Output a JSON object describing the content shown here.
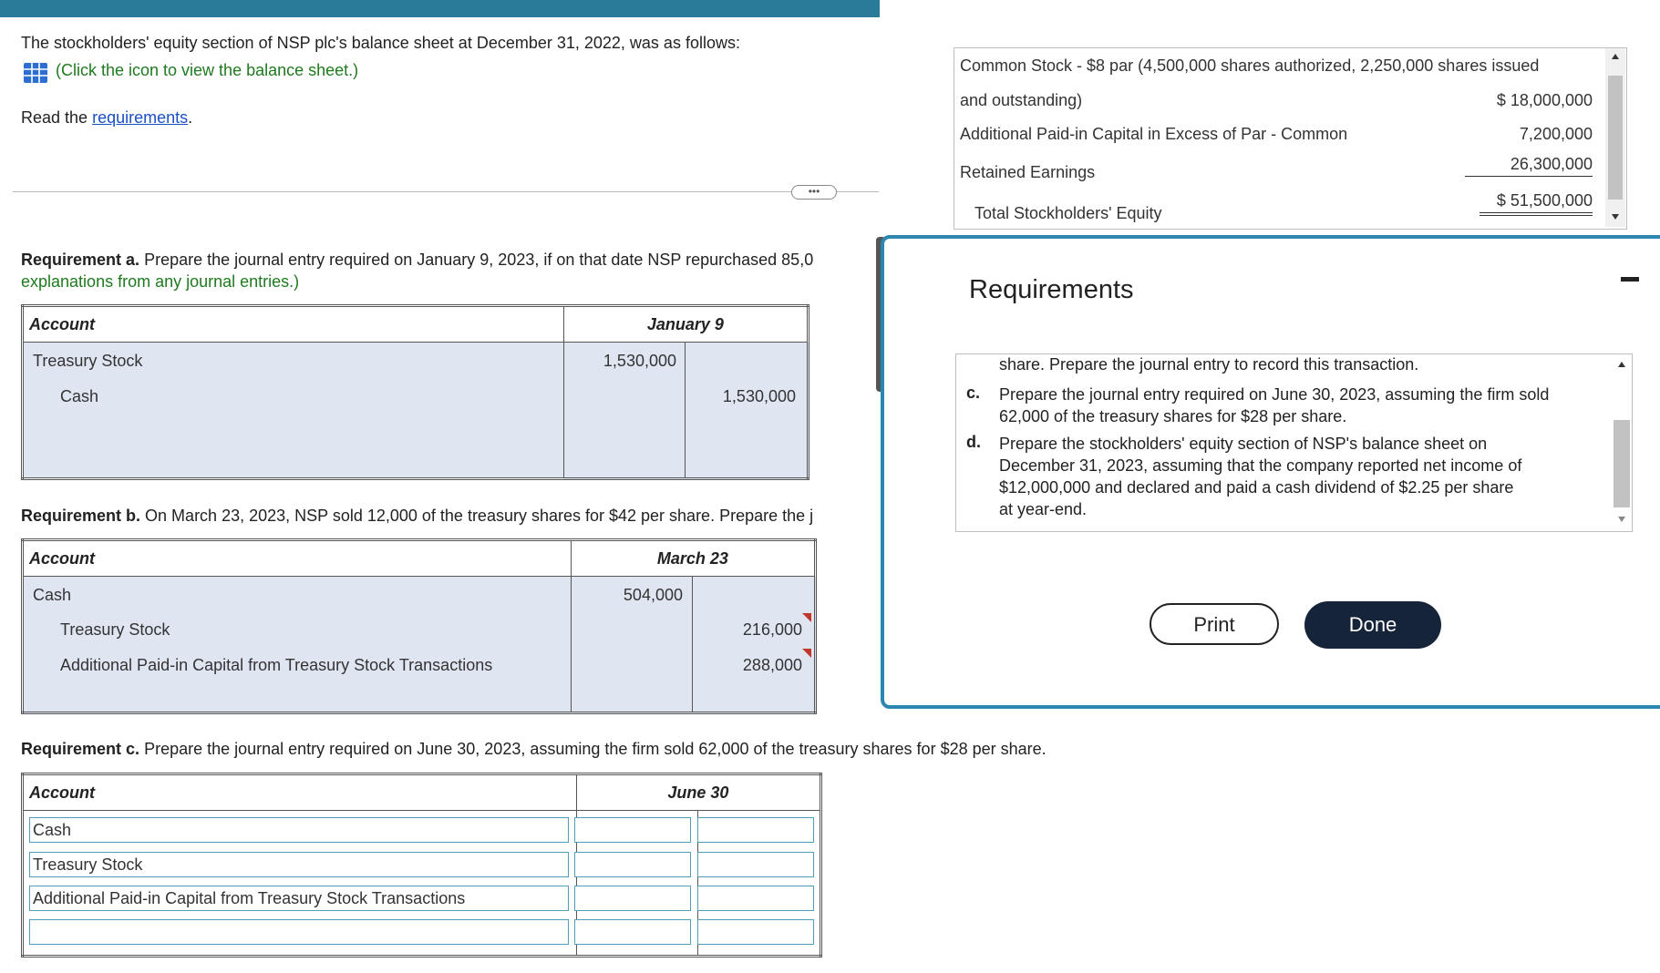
{
  "intro": {
    "line1": "The stockholders' equity section of NSP plc's balance sheet at December 31, 2022, was as follows:",
    "click_icon": "(Click the icon to view the balance sheet.)",
    "read_prefix": "Read the",
    "read_link": "requirements",
    "read_suffix": "."
  },
  "more_dots": "•••",
  "req_a": {
    "head": "Requirement a.",
    "text": "Prepare the journal entry required on January 9, 2023, if on that date NSP repurchased 85,0",
    "text2": "explanations from any journal entries.)",
    "col_account": "Account",
    "col_date": "January 9",
    "rows": [
      {
        "account": "Treasury Stock",
        "debit": "1,530,000",
        "credit": ""
      },
      {
        "account": "Cash",
        "debit": "",
        "credit": "1,530,000"
      }
    ]
  },
  "req_b": {
    "head": "Requirement b.",
    "text": "On March 23, 2023, NSP sold 12,000 of the treasury shares for $42 per share. Prepare the j",
    "col_account": "Account",
    "col_date": "March 23",
    "rows": [
      {
        "account": "Cash",
        "debit": "504,000",
        "credit": ""
      },
      {
        "account": "Treasury Stock",
        "debit": "",
        "credit": "216,000"
      },
      {
        "account": "Additional Paid-in Capital from Treasury Stock Transactions",
        "debit": "",
        "credit": "288,000"
      }
    ]
  },
  "req_c": {
    "head": "Requirement c.",
    "text": "Prepare the journal entry required on June 30, 2023, assuming the firm sold 62,000 of the treasury shares for $28 per share.",
    "col_account": "Account",
    "col_date": "June 30",
    "rows": [
      {
        "account": "Cash",
        "debit": "",
        "credit": ""
      },
      {
        "account": "Treasury Stock",
        "debit": "",
        "credit": ""
      },
      {
        "account": "Additional Paid-in Capital from Treasury Stock Transactions",
        "debit": "",
        "credit": ""
      },
      {
        "account": "",
        "debit": "",
        "credit": ""
      }
    ]
  },
  "balance_sheet": {
    "line1": "Common Stock - $8 par (4,500,000 shares authorized, 2,250,000 shares issued",
    "line2": "and outstanding)",
    "line2_value": "$  18,000,000",
    "line3": "Additional Paid-in Capital in Excess of Par - Common",
    "line3_value": "7,200,000",
    "line4": "Retained Earnings",
    "line4_value": "26,300,000",
    "line5": "Total Stockholders' Equity",
    "line5_value": "$  51,500,000"
  },
  "requirements_modal": {
    "title": "Requirements",
    "b_tail": "share. Prepare the journal entry to record this transaction.",
    "c_letter": "c.",
    "c_text1": "Prepare the journal entry required on June 30, 2023, assuming the firm sold",
    "c_text2": "62,000 of the treasury shares for $28 per share.",
    "d_letter": "d.",
    "d_text1": "Prepare the stockholders' equity section of NSP's balance sheet on",
    "d_text2": "December 31, 2023, assuming that the company reported net income of",
    "d_text3": "$12,000,000 and declared and paid a cash dividend of $2.25 per share",
    "d_text4": "at year-end.",
    "print_label": "Print",
    "done_label": "Done"
  },
  "colors": {
    "accent": "#2c86b0",
    "done_bg": "#16243a",
    "link": "#1a4fc4",
    "green": "#1f7a1f"
  }
}
